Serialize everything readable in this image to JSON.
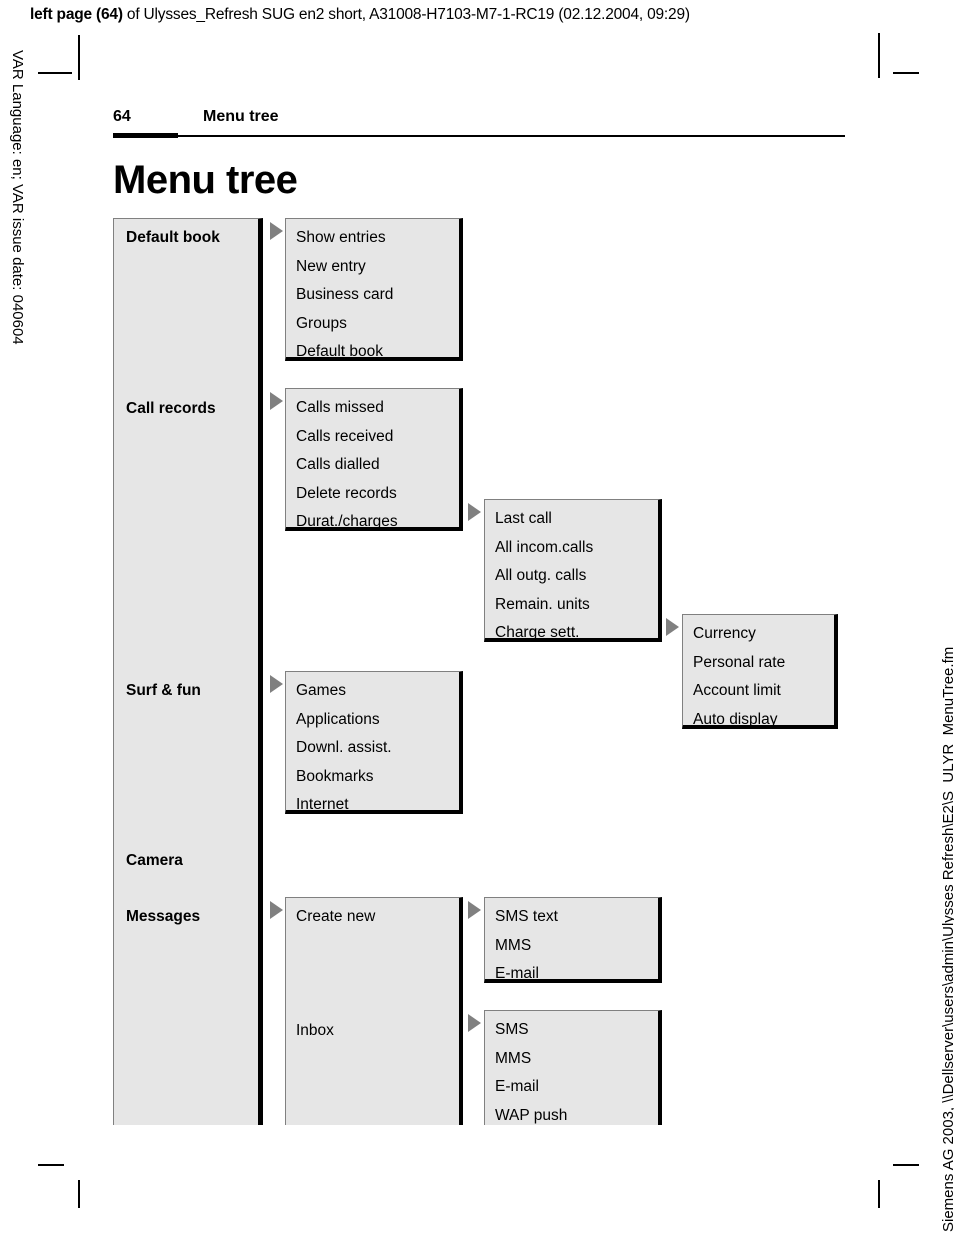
{
  "print_header": {
    "bold_part": "left page (64)",
    "rest": " of Ulysses_Refresh SUG en2 short, A31008-H7103-M7-1-RC19 (02.12.2004, 09:29)"
  },
  "side_texts": {
    "left": "VAR Language: en; VAR issue date: 040604",
    "right": "Siemens AG 2003, \\\\Dellserver\\users\\admin\\Ulysses Refresh\\E2\\S_ULYR_MenuTree.fm"
  },
  "page_header": {
    "page_number": "64",
    "running_title": "Menu tree"
  },
  "chapter_title": "Menu tree",
  "menu_tree": {
    "level1": [
      {
        "label": "Default book",
        "has_arrow": true
      },
      {
        "label": "Call records",
        "has_arrow": true
      },
      {
        "label": "Surf & fun",
        "has_arrow": true
      },
      {
        "label": "Camera",
        "has_arrow": false
      },
      {
        "label": "Messages",
        "has_arrow": true
      }
    ],
    "default_book_submenu": [
      "Show entries",
      "New entry",
      "Business card",
      "Groups",
      "Default book"
    ],
    "call_records_submenu": [
      "Calls missed",
      "Calls received",
      "Calls dialled",
      "Delete records",
      "Durat./charges"
    ],
    "durat_charges_submenu": [
      "Last call",
      "All incom.calls",
      "All outg. calls",
      "Remain. units",
      "Charge sett."
    ],
    "charge_sett_submenu": [
      "Currency",
      "Personal rate",
      "Account limit",
      "Auto display"
    ],
    "surf_fun_submenu": [
      "Games",
      "Applications",
      "Downl. assist.",
      "Bookmarks",
      "Internet"
    ],
    "messages_submenu": [
      "Create new",
      "Inbox"
    ],
    "create_new_submenu": [
      "SMS text",
      "MMS",
      "E-mail"
    ],
    "inbox_submenu": [
      "SMS",
      "MMS",
      "E-mail",
      "WAP push"
    ]
  },
  "colors": {
    "box_fill": "#e6e6e6",
    "box_shadow": "#000000",
    "box_border": "#808080",
    "arrow": "#808080"
  }
}
